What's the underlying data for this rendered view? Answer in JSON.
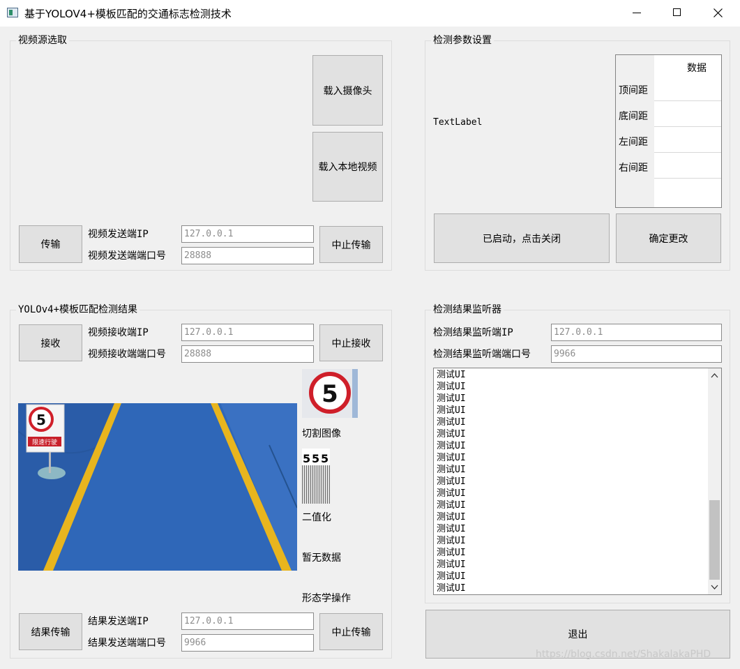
{
  "window": {
    "title": "基于YOLOV4+模板匹配的交通标志检测技术"
  },
  "video_source": {
    "group_title": "视频源选取",
    "load_camera_label": "载入摄像头",
    "load_local_video_label": "载入本地视频",
    "transmit_label": "传输",
    "send_ip_label": "视频发送端IP",
    "send_ip_value": "127.0.0.1",
    "send_port_label": "视频发送端端口号",
    "send_port_value": "28888",
    "stop_label": "中止传输"
  },
  "detection_params": {
    "group_title": "检测参数设置",
    "text_label": "TextLabel",
    "table": {
      "column_header": "数据",
      "rows": [
        "顶间距",
        "底间距",
        "左间距",
        "右间距"
      ]
    },
    "toggle_label": "已启动，点击关闭",
    "confirm_label": "确定更改"
  },
  "yolo_result": {
    "group_title": "YOLOv4+模板匹配检测结果",
    "receive_label": "接收",
    "recv_ip_label": "视频接收端IP",
    "recv_ip_value": "127.0.0.1",
    "recv_port_label": "视频接收端端口号",
    "recv_port_value": "28888",
    "stop_label": "中止接收",
    "crop_label": "切割图像",
    "binarize_label": "二值化",
    "no_data_label": "暂无数据",
    "morph_label": "形态学操作",
    "result_transmit_label": "结果传输",
    "result_ip_label": "结果发送端IP",
    "result_ip_value": "127.0.0.1",
    "result_port_label": "结果发送端端口号",
    "result_port_value": "9966",
    "result_stop_label": "中止传输",
    "sign_speed": "5",
    "sign_text": "限速行驶"
  },
  "monitor": {
    "group_title": "检测结果监听器",
    "ip_label": "检测结果监听端IP",
    "ip_value": "127.0.0.1",
    "port_label": "检测结果监听端端口号",
    "port_value": "9966",
    "log_lines": [
      "测试UI",
      "测试UI",
      "测试UI",
      "测试UI",
      "测试UI",
      "测试UI",
      "测试UI",
      "测试UI",
      "测试UI",
      "测试UI",
      "测试UI",
      "测试UI",
      "测试UI",
      "测试UI",
      "测试UI",
      "测试UI",
      "测试UI",
      "测试UI",
      "测试UI"
    ]
  },
  "exit_label": "退出",
  "watermark": "https://blog.csdn.net/ShakalakaPHD"
}
